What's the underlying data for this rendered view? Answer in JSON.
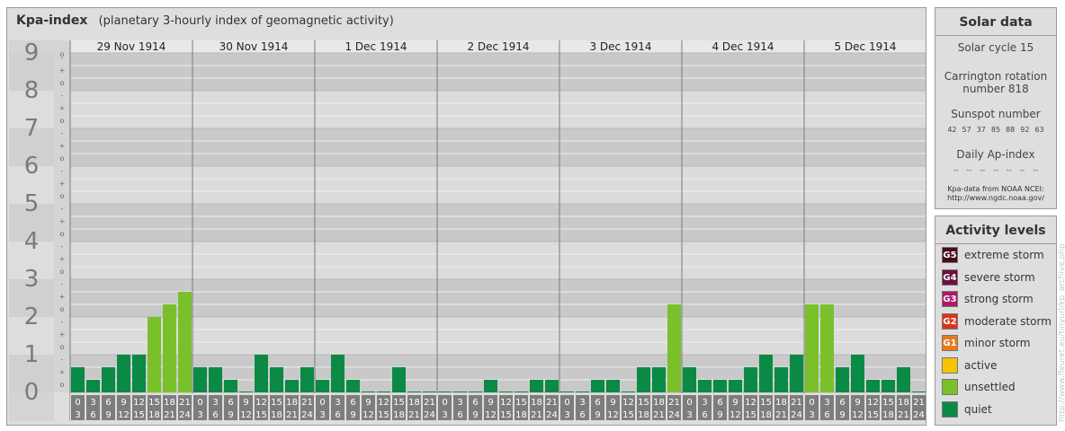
{
  "title": "Kpa-index",
  "subtitle": "(planetary 3-hourly index of geomagnetic activity)",
  "solar": {
    "heading": "Solar data",
    "cycle": "Solar cycle 15",
    "carrington_line1": "Carrington rotation",
    "carrington_line2": "number 818",
    "sunspot_label": "Sunspot number",
    "sunspot_values": [
      "42",
      "57",
      "37",
      "85",
      "88",
      "92",
      "63"
    ],
    "ap_label": "Daily Ap-index",
    "ap_values": [
      "--",
      "--",
      "--",
      "--",
      "--",
      "--",
      "--"
    ],
    "source_line1": "Kpa-data from NOAA NCEI:",
    "source_line2": "http://www.ngdc.noaa.gov/"
  },
  "activity": {
    "heading": "Activity levels",
    "levels": [
      {
        "code": "G5",
        "label": "extreme storm",
        "color": "#4a0a1e"
      },
      {
        "code": "G4",
        "label": "severe storm",
        "color": "#6b1040"
      },
      {
        "code": "G3",
        "label": "strong storm",
        "color": "#b0186a"
      },
      {
        "code": "G2",
        "label": "moderate storm",
        "color": "#d8361c"
      },
      {
        "code": "G1",
        "label": "minor storm",
        "color": "#e87a1a"
      },
      {
        "code": "",
        "label": "active",
        "color": "#f5c400"
      },
      {
        "code": "",
        "label": "unsettled",
        "color": "#7ac02a"
      },
      {
        "code": "",
        "label": "quiet",
        "color": "#0a8a45"
      }
    ]
  },
  "watermark": "http://www.fleuret.eu/tinyurl/kp_archive.php",
  "chart_data": {
    "type": "bar",
    "days": [
      "29 Nov 1914",
      "30 Nov 1914",
      "1 Dec 1914",
      "2 Dec 1914",
      "3 Dec 1914",
      "4 Dec 1914",
      "5 Dec 1914"
    ],
    "y_ticks": [
      "0",
      "1",
      "2",
      "3",
      "4",
      "5",
      "6",
      "7",
      "8",
      "9"
    ],
    "y_minor_marks": [
      "o",
      "+",
      "-"
    ],
    "x_interval_start": [
      "0",
      "3",
      "6",
      "9",
      "12",
      "15",
      "18",
      "21"
    ],
    "x_interval_end": [
      "3",
      "6",
      "9",
      "12",
      "15",
      "18",
      "21",
      "24"
    ],
    "ylim": [
      0,
      9
    ],
    "values": [
      [
        0.667,
        0.333,
        0.667,
        1.0,
        1.0,
        2.0,
        2.333,
        2.667
      ],
      [
        0.667,
        0.667,
        0.333,
        0.0,
        1.0,
        0.667,
        0.333,
        0.667
      ],
      [
        0.333,
        1.0,
        0.333,
        0.0,
        0.0,
        0.667,
        0.0,
        0.0
      ],
      [
        0.0,
        0.0,
        0.0,
        0.333,
        0.0,
        0.0,
        0.333,
        0.333
      ],
      [
        0.0,
        0.0,
        0.333,
        0.333,
        0.0,
        0.667,
        0.667,
        2.333
      ],
      [
        0.667,
        0.333,
        0.333,
        0.333,
        0.667,
        1.0,
        0.667,
        1.0
      ],
      [
        2.333,
        2.333,
        0.667,
        1.0,
        0.333,
        0.333,
        0.667,
        0.0
      ]
    ],
    "colors": {
      "quiet": "#0a8a45",
      "unsettled": "#7ac02a"
    }
  }
}
